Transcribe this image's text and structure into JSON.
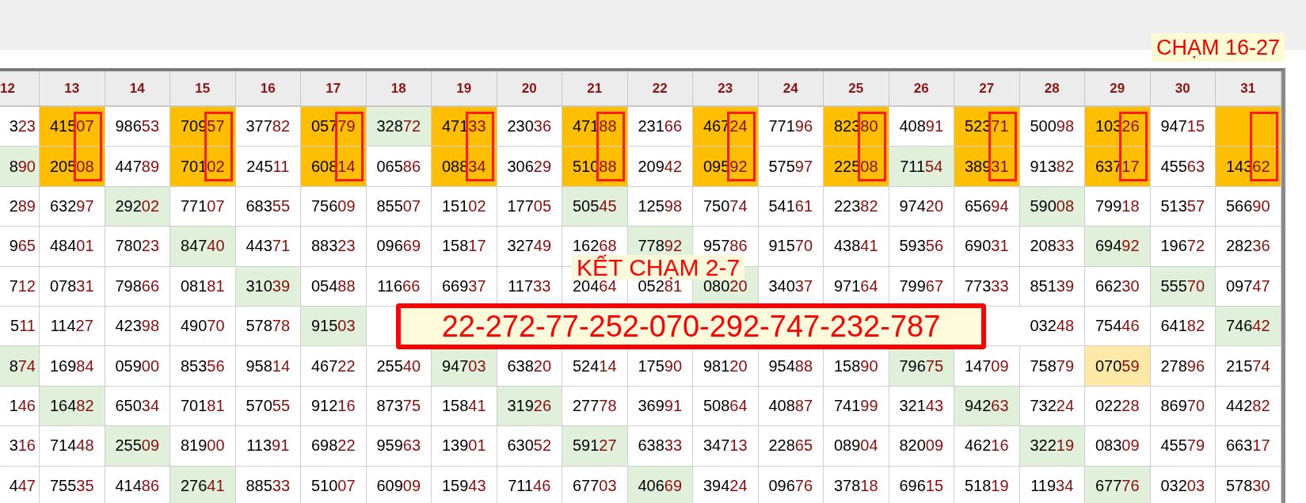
{
  "title": "CHẠM 16-27",
  "columns": [
    {
      "label": "12",
      "marked": false
    },
    {
      "label": "13",
      "marked": true
    },
    {
      "label": "14",
      "marked": false
    },
    {
      "label": "15",
      "marked": true
    },
    {
      "label": "16",
      "marked": false
    },
    {
      "label": "17",
      "marked": true
    },
    {
      "label": "18",
      "marked": false
    },
    {
      "label": "19",
      "marked": true
    },
    {
      "label": "20",
      "marked": false
    },
    {
      "label": "21",
      "marked": true
    },
    {
      "label": "22",
      "marked": false
    },
    {
      "label": "23",
      "marked": true
    },
    {
      "label": "24",
      "marked": false
    },
    {
      "label": "25",
      "marked": true
    },
    {
      "label": "26",
      "marked": false
    },
    {
      "label": "27",
      "marked": true
    },
    {
      "label": "28",
      "marked": false
    },
    {
      "label": "29",
      "marked": true
    },
    {
      "label": "30",
      "marked": false
    },
    {
      "label": "31",
      "marked": true
    }
  ],
  "rows": [
    {
      "cells": [
        {
          "text": "323"
        },
        {
          "text": "41507",
          "color": "#ffbf00"
        },
        {
          "text": "98653"
        },
        {
          "text": "70957",
          "color": "#ffbf00"
        },
        {
          "text": "37782"
        },
        {
          "text": "05779",
          "color": "#ffbf00"
        },
        {
          "text": "32872",
          "color": "#e1f0da"
        },
        {
          "text": "47133",
          "color": "#ffbf00"
        },
        {
          "text": "23036"
        },
        {
          "text": "47188",
          "color": "#ffbf00"
        },
        {
          "text": "23166"
        },
        {
          "text": "46724",
          "color": "#ffbf00"
        },
        {
          "text": "77196"
        },
        {
          "text": "82380",
          "color": "#ffbf00"
        },
        {
          "text": "40891"
        },
        {
          "text": "52371",
          "color": "#ffbf00"
        },
        {
          "text": "50098"
        },
        {
          "text": "10326",
          "color": "#ffbf00"
        },
        {
          "text": "94715"
        },
        {
          "color": "#ffbf00"
        }
      ]
    },
    {
      "cells": [
        {
          "text": "890",
          "color": "#e1f0da"
        },
        {
          "text": "20508",
          "color": "#ffbf00"
        },
        {
          "text": "44789"
        },
        {
          "text": "70102",
          "color": "#ffbf00"
        },
        {
          "text": "24511"
        },
        {
          "text": "60814",
          "color": "#ffbf00"
        },
        {
          "text": "06586"
        },
        {
          "text": "08834",
          "color": "#ffbf00"
        },
        {
          "text": "30629"
        },
        {
          "text": "51088",
          "color": "#ffbf00"
        },
        {
          "text": "20942"
        },
        {
          "text": "09592",
          "color": "#ffbf00"
        },
        {
          "text": "57597"
        },
        {
          "text": "22508",
          "color": "#ffbf00"
        },
        {
          "text": "71154",
          "color": "#e1f0da"
        },
        {
          "text": "38931",
          "color": "#ffbf00"
        },
        {
          "text": "91382"
        },
        {
          "text": "63717",
          "color": "#ffbf00"
        },
        {
          "text": "45563"
        },
        {
          "text": "14362",
          "color": "#ffbf00"
        }
      ]
    },
    {
      "cells": [
        {
          "text": "289"
        },
        {
          "text": "63297"
        },
        {
          "text": "29202",
          "color": "#e1f0da"
        },
        {
          "text": "77107"
        },
        {
          "text": "68355"
        },
        {
          "text": "75609"
        },
        {
          "text": "85507"
        },
        {
          "text": "15102"
        },
        {
          "text": "17705"
        },
        {
          "text": "50545",
          "color": "#e1f0da"
        },
        {
          "text": "12598"
        },
        {
          "text": "75074"
        },
        {
          "text": "54161"
        },
        {
          "text": "22382"
        },
        {
          "text": "97420"
        },
        {
          "text": "65694"
        },
        {
          "text": "59008",
          "color": "#e1f0da"
        },
        {
          "text": "79918"
        },
        {
          "text": "51357"
        },
        {
          "text": "56690"
        }
      ]
    },
    {
      "cells": [
        {
          "text": "965"
        },
        {
          "text": "48401"
        },
        {
          "text": "78023"
        },
        {
          "text": "84740",
          "color": "#e1f0da"
        },
        {
          "text": "44371"
        },
        {
          "text": "88323"
        },
        {
          "text": "09669"
        },
        {
          "text": "15817"
        },
        {
          "text": "32749"
        },
        {
          "text": "16268"
        },
        {
          "text": "77892",
          "color": "#e1f0da"
        },
        {
          "text": "95786"
        },
        {
          "text": "91570"
        },
        {
          "text": "43841"
        },
        {
          "text": "59356"
        },
        {
          "text": "69031"
        },
        {
          "text": "20833"
        },
        {
          "text": "69492",
          "color": "#e1f0da"
        },
        {
          "text": "19672"
        },
        {
          "text": "28236"
        }
      ]
    },
    {
      "cells": [
        {
          "text": "712"
        },
        {
          "text": "07831"
        },
        {
          "text": "79866"
        },
        {
          "text": "08181"
        },
        {
          "text": "31039",
          "color": "#e1f0da"
        },
        {
          "text": "05488"
        },
        {
          "text": "11666"
        },
        {
          "text": "66937"
        },
        {
          "text": "11733"
        },
        {
          "text": "20464"
        },
        {
          "text": "05281"
        },
        {
          "text": "08020",
          "color": "#e1f0da"
        },
        {
          "text": "34037"
        },
        {
          "text": "97164"
        },
        {
          "text": "79967"
        },
        {
          "text": "77333"
        },
        {
          "text": "85139"
        },
        {
          "text": "66230"
        },
        {
          "text": "55570",
          "color": "#e1f0da"
        },
        {
          "text": "09747"
        }
      ]
    },
    {
      "cells": [
        {
          "text": "511"
        },
        {
          "text": "11427"
        },
        {
          "text": "42398"
        },
        {
          "text": "49070"
        },
        {
          "text": "57878"
        },
        {
          "text": "91503",
          "color": "#e1f0da"
        },
        {},
        {},
        {},
        {},
        {},
        {},
        {},
        {},
        {},
        {},
        {
          "text": "03248"
        },
        {
          "text": "75446"
        },
        {
          "text": "64182"
        },
        {
          "text": "74642",
          "color": "#e1f0da"
        }
      ]
    },
    {
      "cells": [
        {
          "text": "874",
          "color": "#e1f0da"
        },
        {
          "text": "16984"
        },
        {
          "text": "05900"
        },
        {
          "text": "85356"
        },
        {
          "text": "95814"
        },
        {
          "text": "46722"
        },
        {
          "text": "25540"
        },
        {
          "text": "94703",
          "color": "#e1f0da"
        },
        {
          "text": "63820"
        },
        {
          "text": "52414"
        },
        {
          "text": "17590"
        },
        {
          "text": "98120"
        },
        {
          "text": "95488"
        },
        {
          "text": "15890"
        },
        {
          "text": "79675",
          "color": "#e1f0da"
        },
        {
          "text": "14709"
        },
        {
          "text": "75879"
        },
        {
          "text": "07059",
          "color": "#ffe9a6"
        },
        {
          "text": "27896"
        },
        {
          "text": "21574"
        }
      ]
    },
    {
      "cells": [
        {
          "text": "146"
        },
        {
          "text": "16482",
          "color": "#e1f0da"
        },
        {
          "text": "65034"
        },
        {
          "text": "70181"
        },
        {
          "text": "57055"
        },
        {
          "text": "91216"
        },
        {
          "text": "87375"
        },
        {
          "text": "15841"
        },
        {
          "text": "31926",
          "color": "#e1f0da"
        },
        {
          "text": "27778"
        },
        {
          "text": "36991"
        },
        {
          "text": "50864"
        },
        {
          "text": "40887"
        },
        {
          "text": "74199"
        },
        {
          "text": "32143"
        },
        {
          "text": "94263",
          "color": "#e1f0da"
        },
        {
          "text": "73224"
        },
        {
          "text": "02228"
        },
        {
          "text": "86970"
        },
        {
          "text": "44282"
        }
      ]
    },
    {
      "cells": [
        {
          "text": "316"
        },
        {
          "text": "71448"
        },
        {
          "text": "25509",
          "color": "#e1f0da"
        },
        {
          "text": "81900"
        },
        {
          "text": "11391"
        },
        {
          "text": "69822"
        },
        {
          "text": "95963"
        },
        {
          "text": "13901"
        },
        {
          "text": "63052"
        },
        {
          "text": "59127",
          "color": "#e1f0da"
        },
        {
          "text": "63833"
        },
        {
          "text": "34713"
        },
        {
          "text": "22865"
        },
        {
          "text": "08904"
        },
        {
          "text": "82009"
        },
        {
          "text": "46216"
        },
        {
          "text": "32219",
          "color": "#e1f0da"
        },
        {
          "text": "08309"
        },
        {
          "text": "45579"
        },
        {
          "text": "66317"
        }
      ]
    },
    {
      "cells": [
        {
          "text": "447"
        },
        {
          "text": "75535"
        },
        {
          "text": "41486"
        },
        {
          "text": "27641",
          "color": "#e1f0da"
        },
        {
          "text": "88533"
        },
        {
          "text": "51007"
        },
        {
          "text": "60909"
        },
        {
          "text": "15943"
        },
        {
          "text": "71146"
        },
        {
          "text": "67703"
        },
        {
          "text": "40669",
          "color": "#e1f0da"
        },
        {
          "text": "39424"
        },
        {
          "text": "09676"
        },
        {
          "text": "37818"
        },
        {
          "text": "69615"
        },
        {
          "text": "51819"
        },
        {
          "text": "11934"
        },
        {
          "text": "67776",
          "color": "#e1f0da"
        },
        {
          "text": "03203"
        },
        {
          "text": "57830"
        }
      ]
    }
  ],
  "note": "KẾT CHẠM 2-7",
  "banner": "22-272-77-252-070-292-747-232-787"
}
